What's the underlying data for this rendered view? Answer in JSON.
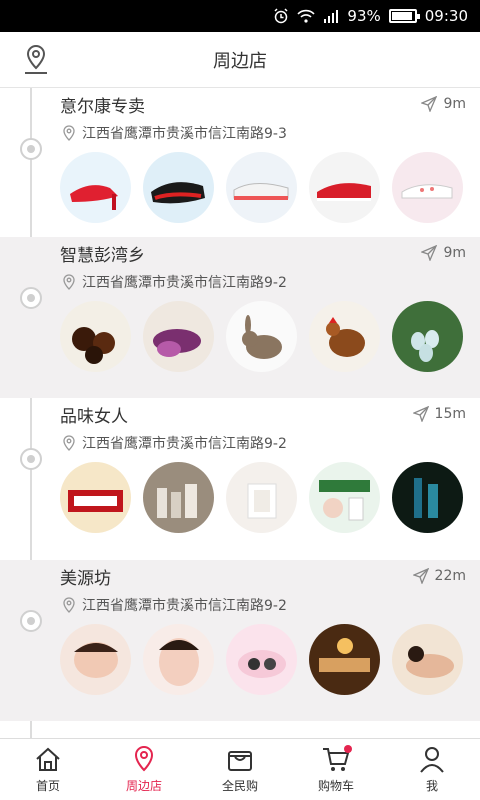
{
  "status_bar": {
    "battery_percent": "93%",
    "time": "09:30",
    "battery_level": 0.93
  },
  "header": {
    "title": "周边店"
  },
  "shops": [
    {
      "name": "意尔康专卖",
      "distance": "9m",
      "address": "江西省鹰潭市贵溪市信江南路9-3",
      "photos": [
        "red-high-heel-shoes",
        "red-black-shoes",
        "white-sneakers",
        "red-loafers",
        "white-flat-shoes"
      ]
    },
    {
      "name": "智慧彭湾乡",
      "distance": "9m",
      "address": "江西省鹰潭市贵溪市信江南路9-2",
      "photos": [
        "preserved-eggs",
        "purple-sweet-potato",
        "rabbit",
        "chicken",
        "duck-eggs"
      ]
    },
    {
      "name": "品味女人",
      "distance": "15m",
      "address": "江西省鹰潭市贵溪市信江南路9-2",
      "photos": [
        "bone-patch-poster",
        "cosmetics-set",
        "skincare-bottles",
        "skincare-poster",
        "serum-bottles"
      ]
    },
    {
      "name": "美源坊",
      "distance": "22m",
      "address": "江西省鹰潭市贵溪市信江南路9-2",
      "photos": [
        "woman-massage",
        "woman-face-care",
        "spa-stones",
        "spa-room",
        "back-massage"
      ]
    }
  ],
  "bottom_nav": [
    {
      "label": "首页",
      "icon": "home-icon",
      "active": false
    },
    {
      "label": "周边店",
      "icon": "location-pin-icon",
      "active": true
    },
    {
      "label": "全民购",
      "icon": "shopping-bag-icon",
      "active": false
    },
    {
      "label": "购物车",
      "icon": "cart-icon",
      "active": false,
      "badge": true
    },
    {
      "label": "我",
      "icon": "person-icon",
      "active": false
    }
  ],
  "colors": {
    "accent": "#e4254f",
    "alt_row": "#f2f0f1",
    "timeline": "#dcdcdc"
  }
}
